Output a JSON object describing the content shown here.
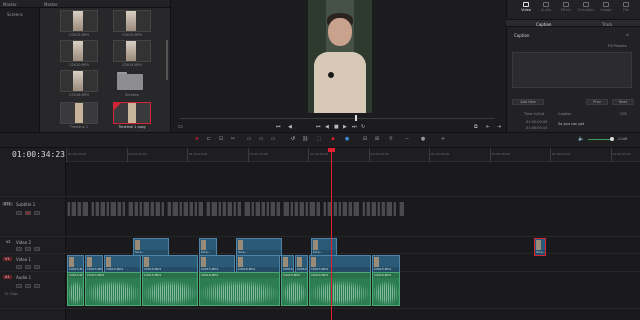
{
  "media_pool": {
    "header_left": "Master",
    "header_right": "Master",
    "bin_item": "Screens",
    "clips": [
      {
        "label": "C0015.MP4",
        "type": "video"
      },
      {
        "label": "C0015.MP4",
        "type": "video"
      },
      {
        "label": "C0010.MP4",
        "type": "video"
      },
      {
        "label": "C0014.MP4",
        "type": "video"
      },
      {
        "label": "C0016.MP4",
        "type": "video"
      },
      {
        "label": "Screens",
        "type": "folder"
      },
      {
        "label": "Timeline 1",
        "type": "timeline"
      },
      {
        "label": "Timeline 1 copy",
        "type": "timeline",
        "selected": true
      }
    ]
  },
  "inspector": {
    "tabs": [
      "Video",
      "Audio",
      "Effect",
      "Transition",
      "Image",
      "File"
    ],
    "active_tab": "Video",
    "subtabs": [
      "Caption",
      "Track"
    ],
    "section_title": "Caption",
    "side_label": "Fill Presets",
    "add_new_label": "Add New",
    "prev_label": "Prev",
    "next_label": "Next",
    "list_header_time": "Time in/Out",
    "list_header_caption": "Caption",
    "list_header_right": "CPS",
    "entries": [
      {
        "time_in": "01:00:00:00",
        "time_out": "01:00:00:14",
        "caption": "So you can get"
      }
    ]
  },
  "timeline": {
    "timecode": "01:00:34:23",
    "ruler_ticks": [
      "01:00:00:00",
      "01:00:05:00",
      "01:00:10:00",
      "01:00:15:00",
      "01:00:20:00",
      "01:00:25:00",
      "01:00:30:00",
      "01:00:35:00",
      "01:00:40:00",
      "01:00:45:00",
      "01:00:50:00",
      "01:00:55:00",
      "01:01:00:00"
    ],
    "tracks": {
      "subtitle": {
        "id": "ST1",
        "name": "Subtitle 1"
      },
      "video2": {
        "id": "V2",
        "name": "Video 2"
      },
      "video1": {
        "id": "V1",
        "name": "Video 1"
      },
      "audio1": {
        "id": "A1",
        "name": "Audio 1",
        "clips_count": "12 Clips"
      }
    },
    "video1_clips": [
      "C0015.M...",
      "C0015.MP4",
      "C0015.MP4",
      "C0016.MP4",
      "C0015.MP4",
      "C0016.MP4",
      "C0015.MP4",
      "C0016.MP4",
      "C0015.MP4",
      "C0015.MP4"
    ],
    "video2_clips": [
      "Scre...",
      "Scre...",
      "Scre...",
      "Scre...",
      "Scre..."
    ],
    "audio_clips": [
      "C0015.M...",
      "C0015.MP4",
      "C0015.MP4",
      "C0016.MP4",
      "C0015.MP4",
      "C0016.MP4",
      "C0016.MP4"
    ],
    "zoom_label": "-20dB"
  },
  "colors": {
    "accent_red": "#e0202e",
    "video_clip": "#2b5a78",
    "audio_clip": "#2c7e52"
  }
}
